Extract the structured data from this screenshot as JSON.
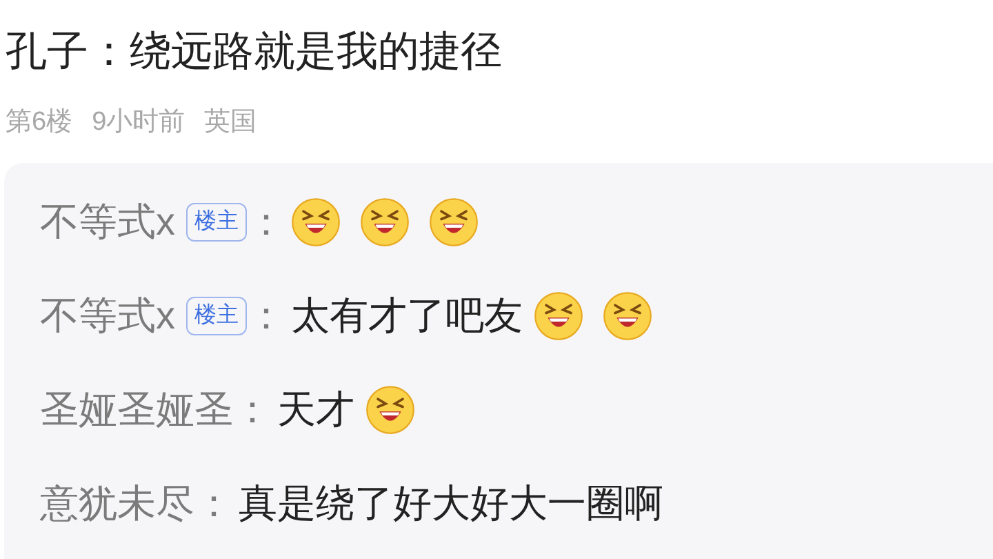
{
  "post": {
    "text": "孔子：绕远路就是我的捷径",
    "floor": "第6楼",
    "time": "9小时前",
    "location": "英国"
  },
  "replies": [
    {
      "author": "不等式x",
      "badge": "楼主",
      "colon": "：",
      "content": [
        {
          "kind": "emoji"
        },
        {
          "kind": "emoji"
        },
        {
          "kind": "emoji"
        }
      ]
    },
    {
      "author": "不等式x",
      "badge": "楼主",
      "colon": "：",
      "content": [
        {
          "kind": "text",
          "text": "太有才了吧友"
        },
        {
          "kind": "emoji"
        },
        {
          "kind": "emoji"
        }
      ]
    },
    {
      "author": "圣娅圣娅圣",
      "colon": "：",
      "content": [
        {
          "kind": "text",
          "text": "天才"
        },
        {
          "kind": "emoji"
        }
      ]
    },
    {
      "author": "意犹未尽",
      "colon": "：",
      "content": [
        {
          "kind": "text",
          "text": "真是绕了好大好大一圈啊"
        }
      ]
    }
  ]
}
